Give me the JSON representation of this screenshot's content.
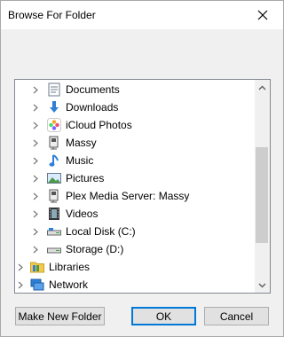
{
  "window": {
    "title": "Browse For Folder"
  },
  "tree": {
    "items": [
      {
        "label": "Documents",
        "icon": "documents-icon"
      },
      {
        "label": "Downloads",
        "icon": "downloads-icon"
      },
      {
        "label": "iCloud Photos",
        "icon": "icloud-photos-icon"
      },
      {
        "label": "Massy",
        "icon": "network-share-icon"
      },
      {
        "label": "Music",
        "icon": "music-icon"
      },
      {
        "label": "Pictures",
        "icon": "pictures-icon"
      },
      {
        "label": "Plex Media Server: Massy",
        "icon": "network-share-icon"
      },
      {
        "label": "Videos",
        "icon": "videos-icon"
      },
      {
        "label": "Local Disk (C:)",
        "icon": "drive-icon"
      },
      {
        "label": "Storage (D:)",
        "icon": "drive-icon"
      },
      {
        "label": "Libraries",
        "icon": "libraries-icon"
      },
      {
        "label": "Network",
        "icon": "network-icon"
      }
    ]
  },
  "buttons": {
    "make_new_folder": "Make New Folder",
    "ok": "OK",
    "cancel": "Cancel"
  },
  "colors": {
    "accent": "#0078d7",
    "folder": "#f2c94c",
    "border": "#828790"
  }
}
